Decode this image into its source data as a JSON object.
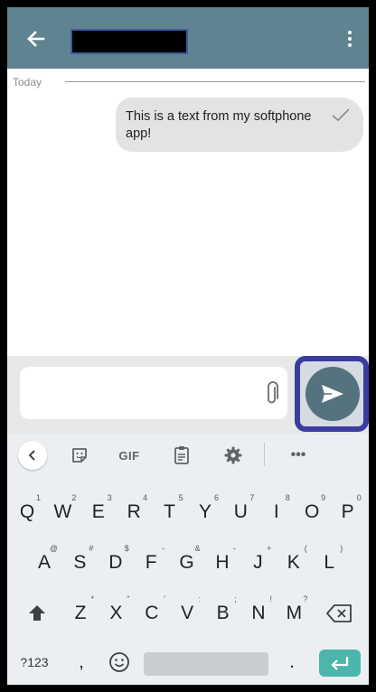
{
  "conversation": {
    "date_divider": "Today",
    "message": "This is a text from my softphone app!"
  },
  "keyboard": {
    "toolbar": {
      "gif_label": "GIF",
      "more_label": "•••"
    },
    "row1": [
      {
        "key": "Q",
        "hint": "1"
      },
      {
        "key": "W",
        "hint": "2"
      },
      {
        "key": "E",
        "hint": "3"
      },
      {
        "key": "R",
        "hint": "4"
      },
      {
        "key": "T",
        "hint": "5"
      },
      {
        "key": "Y",
        "hint": "6"
      },
      {
        "key": "U",
        "hint": "7"
      },
      {
        "key": "I",
        "hint": "8"
      },
      {
        "key": "O",
        "hint": "9"
      },
      {
        "key": "P",
        "hint": "0"
      }
    ],
    "row2": [
      {
        "key": "A",
        "hint": "@"
      },
      {
        "key": "S",
        "hint": "#"
      },
      {
        "key": "D",
        "hint": "$"
      },
      {
        "key": "F",
        "hint": "-"
      },
      {
        "key": "G",
        "hint": "&"
      },
      {
        "key": "H",
        "hint": "-"
      },
      {
        "key": "J",
        "hint": "+"
      },
      {
        "key": "K",
        "hint": "("
      },
      {
        "key": "L",
        "hint": ")"
      }
    ],
    "row3": [
      {
        "key": "Z",
        "hint": "*"
      },
      {
        "key": "X",
        "hint": "\""
      },
      {
        "key": "C",
        "hint": "'"
      },
      {
        "key": "V",
        "hint": ":"
      },
      {
        "key": "B",
        "hint": ";"
      },
      {
        "key": "N",
        "hint": "!"
      },
      {
        "key": "M",
        "hint": "?"
      }
    ],
    "bottom": {
      "symbols_label": "?123",
      "comma": ",",
      "period": "."
    }
  },
  "colors": {
    "app_bar": "#5f8391",
    "send_button": "#55737f",
    "highlight": "#3a3d9e",
    "enter_key": "#4db6ac"
  },
  "icons": [
    "back-arrow-icon",
    "more-vert-icon",
    "check-icon",
    "attachment-icon",
    "send-icon",
    "chevron-left-icon",
    "sticker-icon",
    "clipboard-icon",
    "gear-icon",
    "shift-icon",
    "backspace-icon",
    "emoji-icon",
    "enter-icon"
  ]
}
